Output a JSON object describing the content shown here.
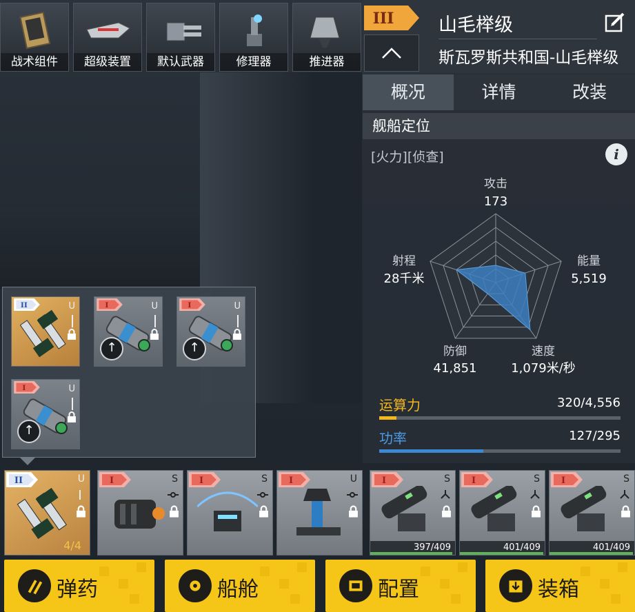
{
  "module_tabs": [
    {
      "label": "战术组件",
      "icon": "tactical-component-icon"
    },
    {
      "label": "超级装置",
      "icon": "super-device-icon"
    },
    {
      "label": "默认武器",
      "icon": "default-weapon-icon"
    },
    {
      "label": "修理器",
      "icon": "repair-device-icon"
    },
    {
      "label": "推进器",
      "icon": "thruster-icon"
    }
  ],
  "ship": {
    "tier": "III",
    "name": "山毛榉级",
    "subtitle": "斯瓦罗斯共和国-山毛榉级"
  },
  "info_tabs": [
    {
      "label": "概况",
      "active": true
    },
    {
      "label": "详情",
      "active": false
    },
    {
      "label": "改装",
      "active": false
    }
  ],
  "section_title": "舰船定位",
  "roles": "[火力][侦查]",
  "stats": {
    "attack_label": "攻击",
    "attack_value": "173",
    "energy_label": "能量",
    "energy_value": "5,519",
    "speed_label": "速度",
    "speed_value": "1,079米/秒",
    "defense_label": "防御",
    "defense_value": "41,851",
    "range_label": "射程",
    "range_value": "28千米"
  },
  "radar_levels": {
    "attack": 0.25,
    "energy": 0.45,
    "speed": 0.85,
    "defense": 0.2,
    "range": 0.6
  },
  "compute": {
    "label": "运算力",
    "value": "320/4,556",
    "fraction": 0.07,
    "color": "#f5b81c"
  },
  "power": {
    "label": "功率",
    "value": "127/295",
    "fraction": 0.43,
    "color": "#3d88d2"
  },
  "popup_slots": [
    {
      "tier": "II",
      "letter": "U",
      "upgrade": false,
      "gold": true
    },
    {
      "tier": "I",
      "letter": "U",
      "upgrade": true,
      "gold": false
    },
    {
      "tier": "I",
      "letter": "U",
      "upgrade": true,
      "gold": false
    },
    {
      "tier": "I",
      "letter": "U",
      "upgrade": true,
      "gold": false
    }
  ],
  "equipment": [
    {
      "tier": "II",
      "letter": "U",
      "gold": true,
      "count": "4/4",
      "hp": "",
      "hp_fraction": 0
    },
    {
      "tier": "I",
      "letter": "S",
      "gold": false,
      "count": "",
      "hp": "",
      "hp_fraction": 0
    },
    {
      "tier": "I",
      "letter": "S",
      "gold": false,
      "count": "",
      "hp": "",
      "hp_fraction": 0
    },
    {
      "tier": "I",
      "letter": "U",
      "gold": false,
      "count": "",
      "hp": "",
      "hp_fraction": 0
    },
    {
      "tier": "I",
      "letter": "S",
      "gold": false,
      "count": "",
      "hp": "397/409",
      "hp_fraction": 0.97
    },
    {
      "tier": "I",
      "letter": "S",
      "gold": false,
      "count": "",
      "hp": "401/409",
      "hp_fraction": 0.98
    },
    {
      "tier": "I",
      "letter": "S",
      "gold": false,
      "count": "",
      "hp": "401/409",
      "hp_fraction": 0.98
    }
  ],
  "actions": [
    {
      "label": "弹药",
      "icon": "ammo-icon"
    },
    {
      "label": "船舱",
      "icon": "cabin-icon"
    },
    {
      "label": "配置",
      "icon": "config-icon"
    },
    {
      "label": "装箱",
      "icon": "crate-icon"
    }
  ]
}
